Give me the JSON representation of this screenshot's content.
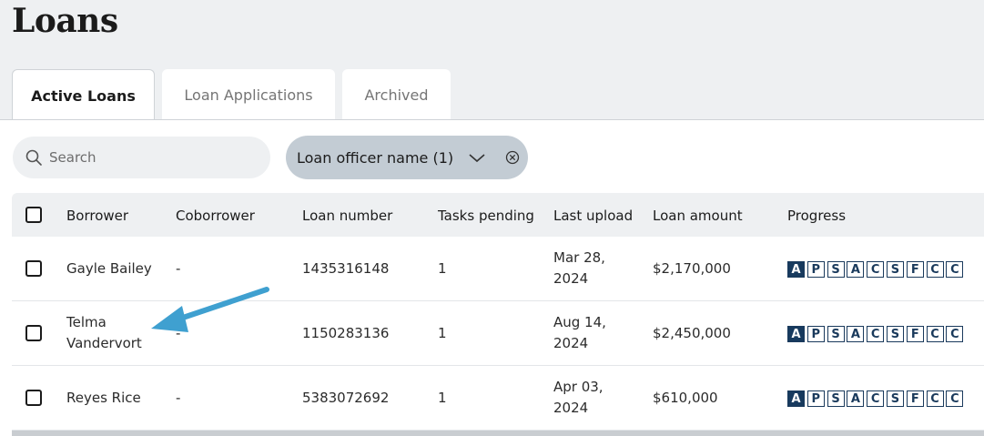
{
  "page": {
    "title": "Loans"
  },
  "tabs": [
    {
      "label": "Active Loans",
      "active": true
    },
    {
      "label": "Loan Applications",
      "active": false
    },
    {
      "label": "Archived",
      "active": false
    }
  ],
  "search": {
    "placeholder": "Search",
    "value": ""
  },
  "filter": {
    "label": "Loan officer name (1)"
  },
  "columns": [
    "Borrower",
    "Coborrower",
    "Loan number",
    "Tasks pending",
    "Last upload",
    "Loan amount",
    "Progress"
  ],
  "rows": [
    {
      "borrower": [
        "Gayle Bailey",
        ""
      ],
      "coborrower": "-",
      "loan_number": "1435316148",
      "tasks": "1",
      "upload": [
        "Mar 28,",
        "2024"
      ],
      "amount": "$2,170,000",
      "completed_steps": 1
    },
    {
      "borrower": [
        "Telma",
        "Vandervort"
      ],
      "coborrower": "-",
      "loan_number": "1150283136",
      "tasks": "1",
      "upload": [
        "Aug 14,",
        "2024"
      ],
      "amount": "$2,450,000",
      "completed_steps": 1
    },
    {
      "borrower": [
        "Reyes Rice",
        ""
      ],
      "coborrower": "-",
      "loan_number": "5383072692",
      "tasks": "1",
      "upload": [
        "Apr 03,",
        "2024"
      ],
      "amount": "$610,000",
      "completed_steps": 1
    }
  ],
  "progress_steps": [
    "A",
    "P",
    "S",
    "A",
    "C",
    "S",
    "F",
    "C",
    "C"
  ],
  "colors": {
    "progress_done": "#173a5e",
    "arrow": "#3fa0d0",
    "chip": "#c3ccd4"
  },
  "icons": {
    "search": "search-icon",
    "chevron": "chevron-down-icon",
    "clear": "clear-circle-icon",
    "annotation": "annotation-arrow"
  }
}
